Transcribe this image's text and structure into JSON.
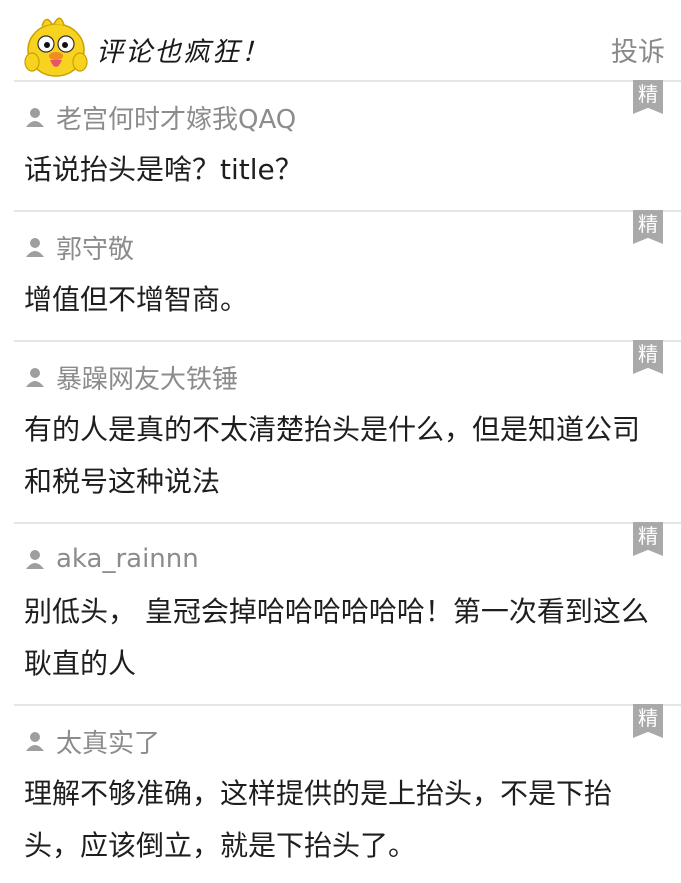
{
  "header": {
    "title": "评论也疯狂！",
    "report_label": "投诉",
    "mascot_icon": "yellow-chick-mascot-icon"
  },
  "badge_label": "精",
  "colors": {
    "divider": "#e6e6e6",
    "badge": "#a9a9a9",
    "author": "#8c8c8c",
    "text": "#1e1e1e"
  },
  "comments": [
    {
      "author": "老宫何时才嫁我QAQ",
      "text": "话说抬头是啥？title？"
    },
    {
      "author": "郭守敬",
      "text": "增值但不增智商。"
    },
    {
      "author": "暴躁网友大铁锤",
      "text": "有的人是真的不太清楚抬头是什么，但是知道公司和税号这种说法"
    },
    {
      "author": "aka_rainnn",
      "text": "别低头， 皇冠会掉哈哈哈哈哈哈！第一次看到这么耿直的人"
    },
    {
      "author": "太真实了",
      "text": "理解不够准确，这样提供的是上抬头，不是下抬头，应该倒立，就是下抬头了。"
    }
  ]
}
